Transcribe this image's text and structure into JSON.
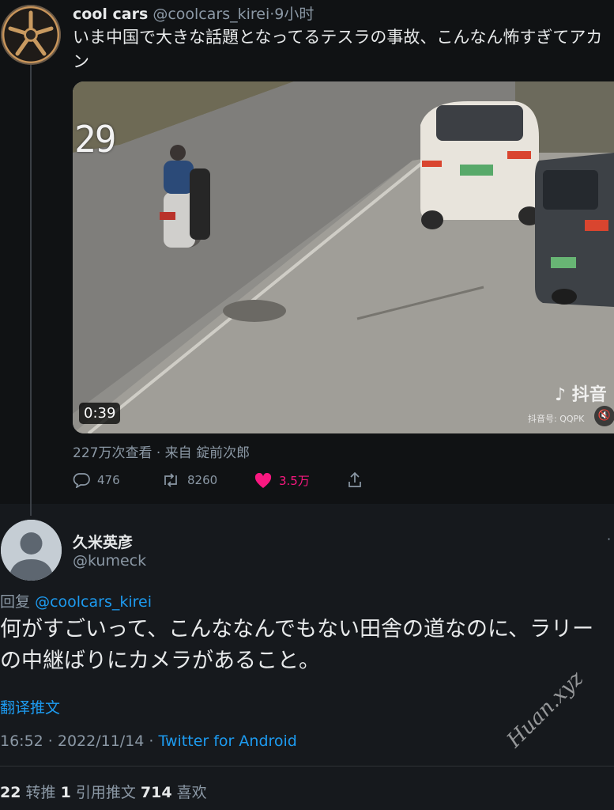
{
  "tweet": {
    "author_name": "cool cars",
    "author_handle": "@coolcars_kirei",
    "separator": "·",
    "time": "9小时",
    "text": "いま中国で大きな話題となってるテスラの事故、こんなん怖すぎてアカン",
    "video": {
      "counter": "29",
      "duration": "0:39",
      "tiktok_brand": "抖音",
      "tiktok_id": "抖音号: QQPK",
      "mute_icon": "speaker-muted-icon"
    },
    "views": "227万次查看 · 来自 錠前次郎",
    "actions": {
      "replies": "476",
      "retweets": "8260",
      "likes": "3.5万"
    }
  },
  "reply": {
    "author_name": "久米英彦",
    "author_handle": "@kumeck",
    "reply_to_prefix": "回复",
    "reply_to_handle": "@coolcars_kirei",
    "text": "何がすごいって、こんななんでもない田舎の道なのに、ラリーの中継ばりにカメラがあること。",
    "translate_label": "翻译推文",
    "timestamp": "16:52 · 2022/11/14 ·",
    "source": "Twitter for Android",
    "stats": {
      "retweets_count": "22",
      "retweets_label": "转推",
      "quotes_count": "1",
      "quotes_label": "引用推文",
      "likes_count": "714",
      "likes_label": "喜欢"
    }
  },
  "watermark": "Huan.xyz",
  "colors": {
    "accent": "#1d9bf0",
    "like": "#f91880",
    "muted": "#8b98a5",
    "text": "#e7e9ea",
    "background": "#15181c"
  }
}
